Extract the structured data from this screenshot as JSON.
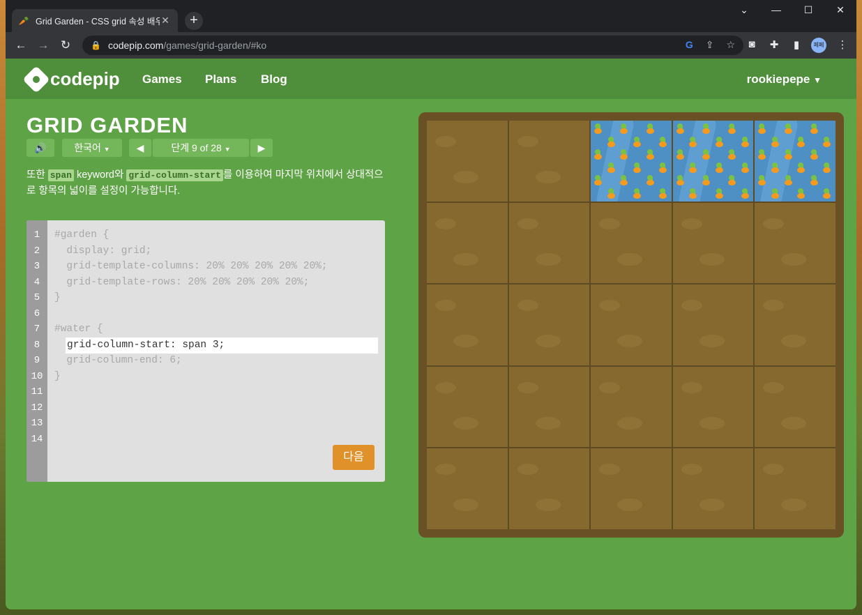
{
  "browser": {
    "tab_title": "Grid Garden - CSS grid 속성 배우기",
    "tab_favicon": "carrot-icon",
    "url_host": "codepip.com",
    "url_path": "/games/grid-garden/#ko",
    "profile_initials": "페페"
  },
  "header": {
    "logo": "codepip",
    "menu": [
      "Games",
      "Plans",
      "Blog"
    ],
    "user": "rookiepepe"
  },
  "game": {
    "title": "GRID GARDEN",
    "language": "한국어",
    "level_label": "단계 9 of 28",
    "description_prefix": "또한 ",
    "description_code1": "span",
    "description_mid": " keyword와 ",
    "description_code2": "grid-column-start",
    "description_suffix": "를 이용하여 마지막 위치에서 상대적으로 항목의 넓이를 설정이 가능합니다.",
    "next_label": "다음"
  },
  "editor": {
    "line_numbers": [
      "1",
      "2",
      "3",
      "4",
      "5",
      "6",
      "7",
      "8",
      "9",
      "10",
      "11",
      "12",
      "13",
      "14"
    ],
    "lines": [
      "#garden {",
      "  display: grid;",
      "  grid-template-columns: 20% 20% 20% 20% 20%;",
      "  grid-template-rows: 20% 20% 20% 20% 20%;",
      "}",
      "",
      "#water {",
      "",
      "  grid-column-end: 6;",
      "}"
    ],
    "input_value": "grid-column-start: span 3;"
  },
  "garden": {
    "columns": 5,
    "rows": 5,
    "water_row": 1,
    "water_column_start": 3,
    "water_column_span": 3
  }
}
